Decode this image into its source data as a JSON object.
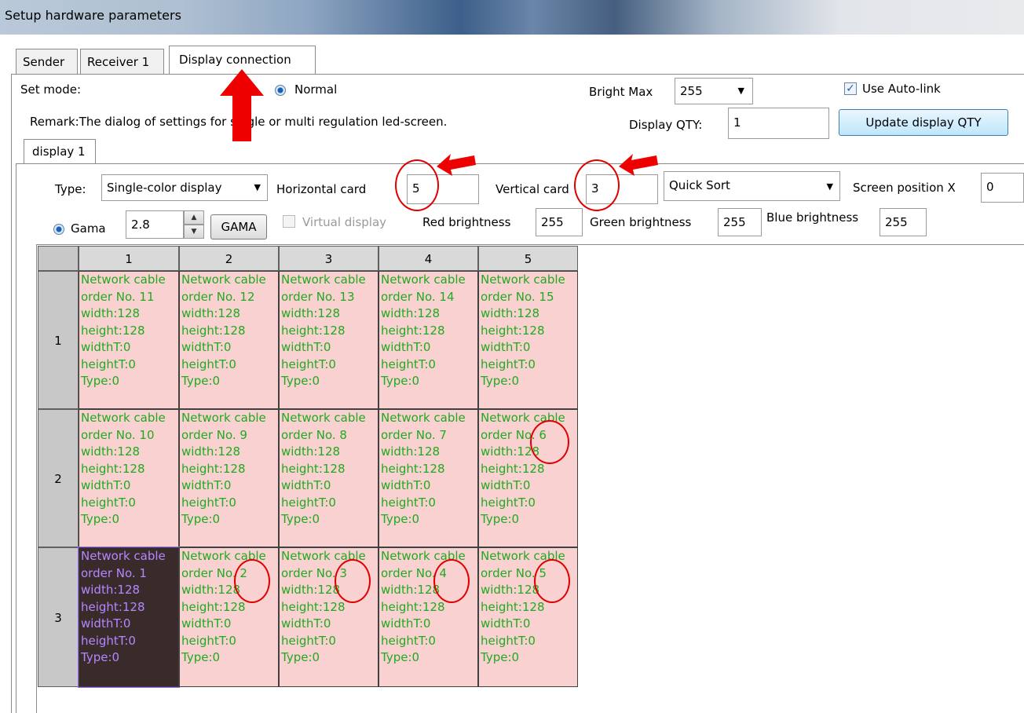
{
  "window": {
    "title": "Setup hardware parameters"
  },
  "tabs": [
    {
      "label": "Sender"
    },
    {
      "label": "Receiver 1"
    },
    {
      "label": "Display connection"
    }
  ],
  "set_mode": {
    "label": "Set mode:",
    "normal_label": "Normal",
    "remark": "Remark:The dialog of settings for single or multi regulation led-screen."
  },
  "bright_max": {
    "label": "Bright Max",
    "value": "255"
  },
  "auto_link": {
    "label": "Use Auto-link",
    "checked": true
  },
  "display_qty": {
    "label": "Display QTY:",
    "value": "1",
    "update_button": "Update display QTY"
  },
  "display_tab": {
    "label": "display 1"
  },
  "settings": {
    "type_label": "Type:",
    "type_value": "Single-color display",
    "horizontal_label": "Horizontal card",
    "horizontal_value": "5",
    "vertical_label": "Vertical card",
    "vertical_value": "3",
    "sort_value": "Quick Sort",
    "screen_pos_label": "Screen position X",
    "screen_pos_value": "0",
    "gama_label": "Gama",
    "gama_value": "2.8",
    "gama_button": "GAMA",
    "virtual_label": "Virtual display",
    "red_label": "Red brightness",
    "red_value": "255",
    "green_label": "Green brightness",
    "green_value": "255",
    "blue_label": "Blue brightness",
    "blue_value": "255"
  },
  "grid": {
    "columns": [
      "1",
      "2",
      "3",
      "4",
      "5"
    ],
    "rows": [
      {
        "label": "1",
        "cells": [
          [
            "Network cable",
            "order No. 11",
            "width:128",
            "height:128",
            "widthT:0",
            "heightT:0",
            "Type:0"
          ],
          [
            "Network cable",
            "order No. 12",
            "width:128",
            "height:128",
            "widthT:0",
            "heightT:0",
            "Type:0"
          ],
          [
            "Network cable",
            "order No. 13",
            "width:128",
            "height:128",
            "widthT:0",
            "heightT:0",
            "Type:0"
          ],
          [
            "Network cable",
            "order No. 14",
            "width:128",
            "height:128",
            "widthT:0",
            "heightT:0",
            "Type:0"
          ],
          [
            "Network cable",
            "order No. 15",
            "width:128",
            "height:128",
            "widthT:0",
            "heightT:0",
            "Type:0"
          ]
        ]
      },
      {
        "label": "2",
        "cells": [
          [
            "Network cable",
            "order No. 10",
            "width:128",
            "height:128",
            "widthT:0",
            "heightT:0",
            "Type:0"
          ],
          [
            "Network cable",
            "order No. 9",
            "width:128",
            "height:128",
            "widthT:0",
            "heightT:0",
            "Type:0"
          ],
          [
            "Network cable",
            "order No. 8",
            "width:128",
            "height:128",
            "widthT:0",
            "heightT:0",
            "Type:0"
          ],
          [
            "Network cable",
            "order No. 7",
            "width:128",
            "height:128",
            "widthT:0",
            "heightT:0",
            "Type:0"
          ],
          [
            "Network cable",
            "order No. 6",
            "width:128",
            "height:128",
            "widthT:0",
            "heightT:0",
            "Type:0"
          ]
        ]
      },
      {
        "label": "3",
        "cells": [
          [
            "Network cable",
            "order No. 1",
            "width:128",
            "height:128",
            "widthT:0",
            "heightT:0",
            "Type:0"
          ],
          [
            "Network cable",
            "order No. 2",
            "width:128",
            "height:128",
            "widthT:0",
            "heightT:0",
            "Type:0"
          ],
          [
            "Network cable",
            "order No. 3",
            "width:128",
            "height:128",
            "widthT:0",
            "heightT:0",
            "Type:0"
          ],
          [
            "Network cable",
            "order No. 4",
            "width:128",
            "height:128",
            "widthT:0",
            "heightT:0",
            "Type:0"
          ],
          [
            "Network cable",
            "order No. 5",
            "width:128",
            "height:128",
            "widthT:0",
            "heightT:0",
            "Type:0"
          ]
        ]
      }
    ],
    "selected_cell": "row 3, column 1"
  },
  "colors": {
    "cell_bg": "#fad1d1",
    "cell_text": "#1faa1f",
    "selected_bg": "#3a2b2b",
    "selected_text": "#b486ff",
    "annotation": "#e00000"
  }
}
